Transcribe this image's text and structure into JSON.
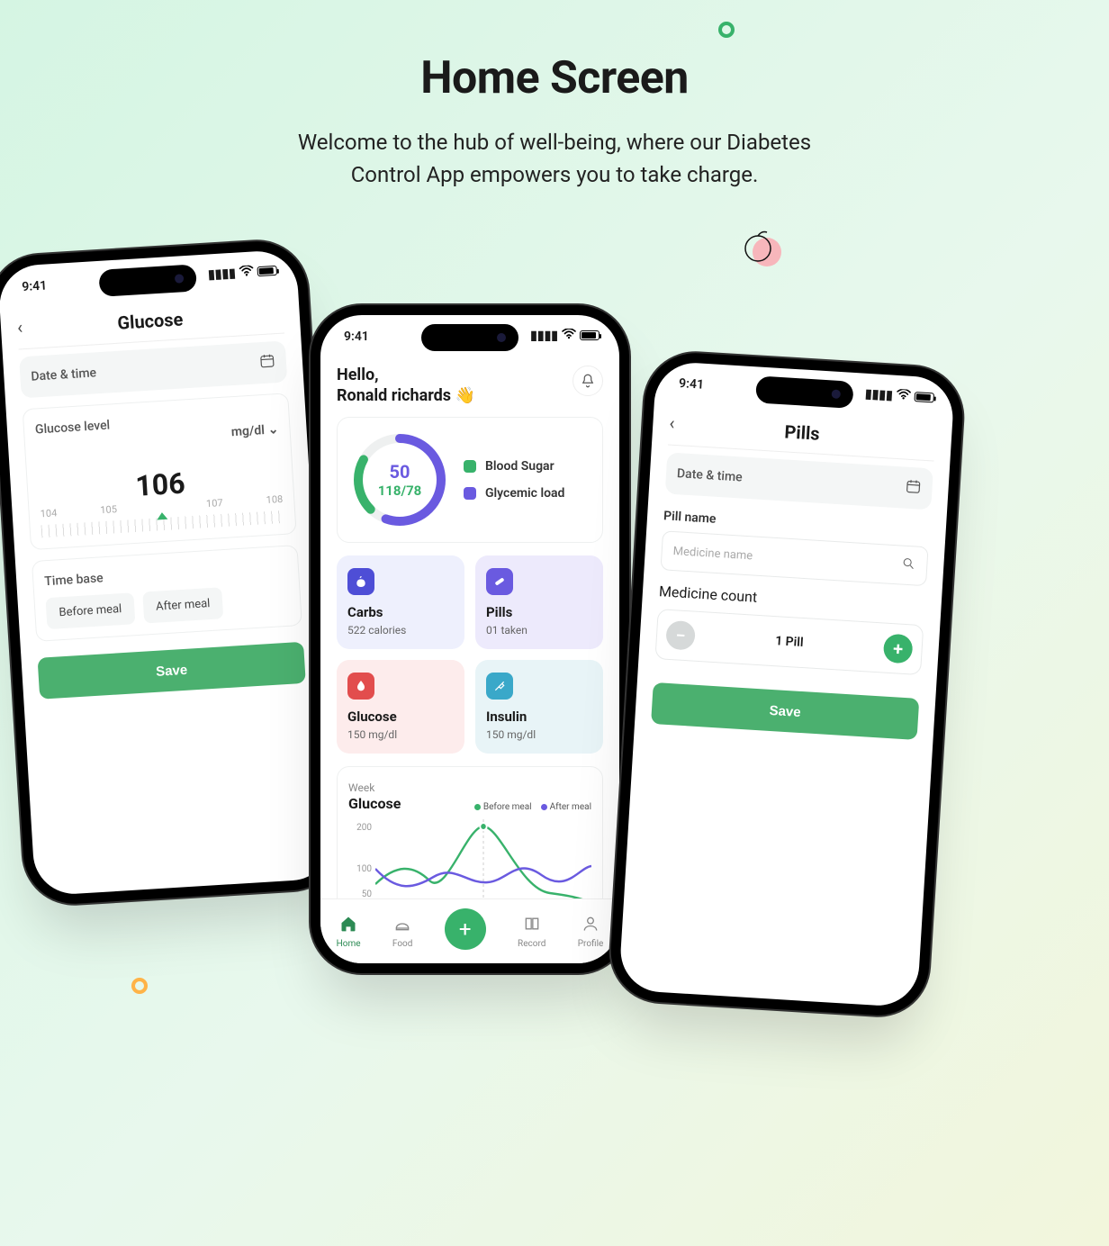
{
  "header": {
    "title": "Home Screen",
    "subtitle": "Welcome to the hub of well-being, where our Diabetes Control App empowers you to take charge."
  },
  "status": {
    "time": "9:41"
  },
  "glucose_screen": {
    "title": "Glucose",
    "datetime_label": "Date & time",
    "level_label": "Glucose level",
    "unit": "mg/dl",
    "ticks": [
      "104",
      "105",
      "106",
      "107",
      "108"
    ],
    "value": "106",
    "timebase_label": "Time base",
    "opt_before": "Before meal",
    "opt_after": "After meal",
    "save": "Save"
  },
  "home_screen": {
    "hello": "Hello,",
    "name": "Ronald richards",
    "gauge": {
      "v1": "50",
      "v2": "118/78"
    },
    "legend": {
      "blood_sugar": "Blood Sugar",
      "glycemic": "Glycemic load"
    },
    "tile_carbs": {
      "title": "Carbs",
      "sub": "522 calories"
    },
    "tile_pills": {
      "title": "Pills",
      "sub": "01 taken"
    },
    "tile_glucose": {
      "title": "Glucose",
      "sub": "150 mg/dl"
    },
    "tile_insulin": {
      "title": "Insulin",
      "sub": "150 mg/dl"
    },
    "chart": {
      "period": "Week",
      "title": "Glucose",
      "legend_before": "Before meal",
      "legend_after": "After meal"
    },
    "tabs": {
      "home": "Home",
      "food": "Food",
      "record": "Record",
      "profile": "Profile"
    }
  },
  "pills_screen": {
    "title": "Pills",
    "datetime_label": "Date & time",
    "name_label": "Pill name",
    "name_placeholder": "Medicine name",
    "count_label": "Medicine count",
    "count_value": "1 Pill",
    "save": "Save"
  },
  "chart_data": {
    "type": "line",
    "title": "Glucose",
    "period": "Week",
    "ylabel": "",
    "ylim": [
      50,
      200
    ],
    "yticks": [
      50,
      100,
      200
    ],
    "x": [
      0,
      1,
      2,
      3,
      4,
      5,
      6
    ],
    "series": [
      {
        "name": "Before meal",
        "color": "#38b26b",
        "values": [
          95,
          120,
          100,
          200,
          140,
          95,
          85
        ]
      },
      {
        "name": "After meal",
        "color": "#6a5ae0",
        "values": [
          120,
          90,
          105,
          95,
          130,
          100,
          120
        ]
      }
    ],
    "highlight_index": 3
  }
}
